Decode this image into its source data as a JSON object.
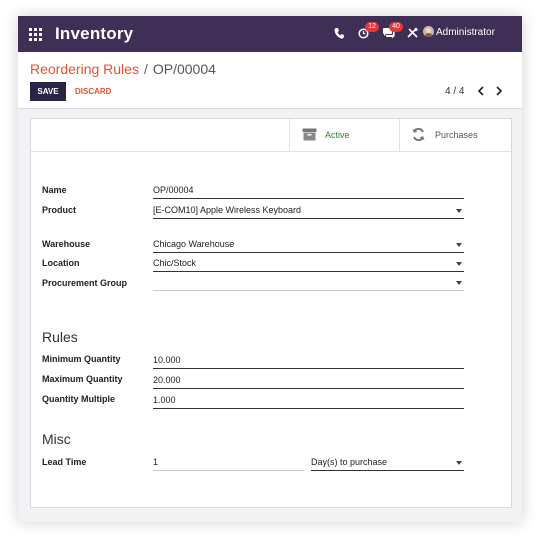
{
  "navbar": {
    "app_title": "Inventory",
    "activity_badge": "12",
    "messages_badge": "40",
    "user_name": "Administrator"
  },
  "breadcrumb": {
    "parent": "Reordering Rules",
    "separator": "/",
    "current": "OP/00004"
  },
  "buttons": {
    "save": "SAVE",
    "discard": "DISCARD"
  },
  "pager": {
    "value": "4 / 4"
  },
  "smart_buttons": {
    "active": "Active",
    "purchases": "Purchases"
  },
  "fields": {
    "name": {
      "label": "Name",
      "value": "OP/00004"
    },
    "product": {
      "label": "Product",
      "value": "[E-COM10] Apple Wireless Keyboard"
    },
    "warehouse": {
      "label": "Warehouse",
      "value": "Chicago Warehouse"
    },
    "location": {
      "label": "Location",
      "value": "Chic/Stock"
    },
    "procurement_group": {
      "label": "Procurement Group",
      "value": ""
    }
  },
  "rules": {
    "title": "Rules",
    "min_qty": {
      "label": "Minimum Quantity",
      "value": "10.000"
    },
    "max_qty": {
      "label": "Maximum Quantity",
      "value": "20.000"
    },
    "qty_multiple": {
      "label": "Quantity Multiple",
      "value": "1.000"
    }
  },
  "misc": {
    "title": "Misc",
    "lead_time": {
      "label": "Lead Time",
      "value": "1",
      "unit": "Day(s) to purchase"
    }
  },
  "colors": {
    "navbar": "#3f2e56",
    "accent": "#e0542e",
    "active_green": "#2f7d32",
    "save_button": "#2a2447"
  }
}
